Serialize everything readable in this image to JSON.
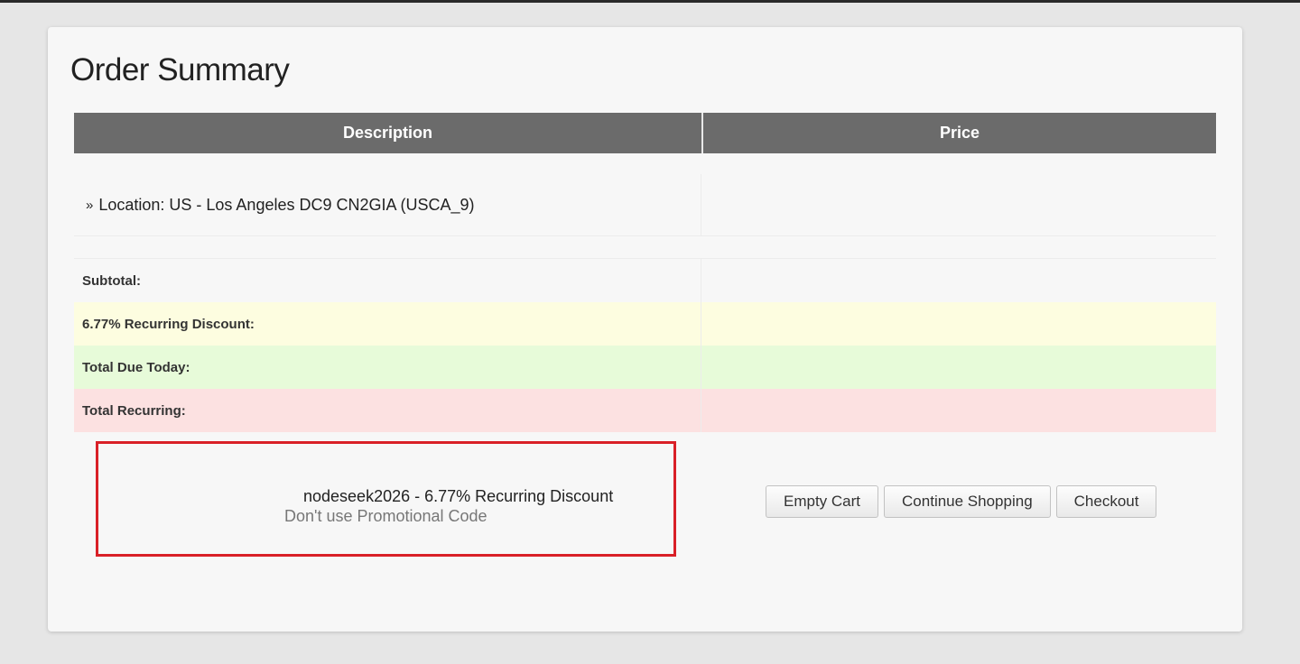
{
  "order_summary": {
    "title": "Order Summary",
    "table": {
      "headers": {
        "description": "Description",
        "price": "Price"
      },
      "items": [
        {
          "prefix": "»",
          "description": "Location: US - Los Angeles DC9 CN2GIA (USCA_9)",
          "price": ""
        }
      ],
      "summary": {
        "subtotal_label": "Subtotal:",
        "discount_label": "6.77% Recurring Discount:",
        "total_due_label": "Total Due Today:",
        "total_recurring_label": "Total Recurring:"
      }
    },
    "promo": {
      "applied_code": "nodeseek2026 - 6.77% Recurring Discount",
      "remove_link": "Don't use Promotional Code"
    },
    "actions": {
      "empty_cart": "Empty Cart",
      "continue_shopping": "Continue Shopping",
      "checkout": "Checkout"
    }
  }
}
